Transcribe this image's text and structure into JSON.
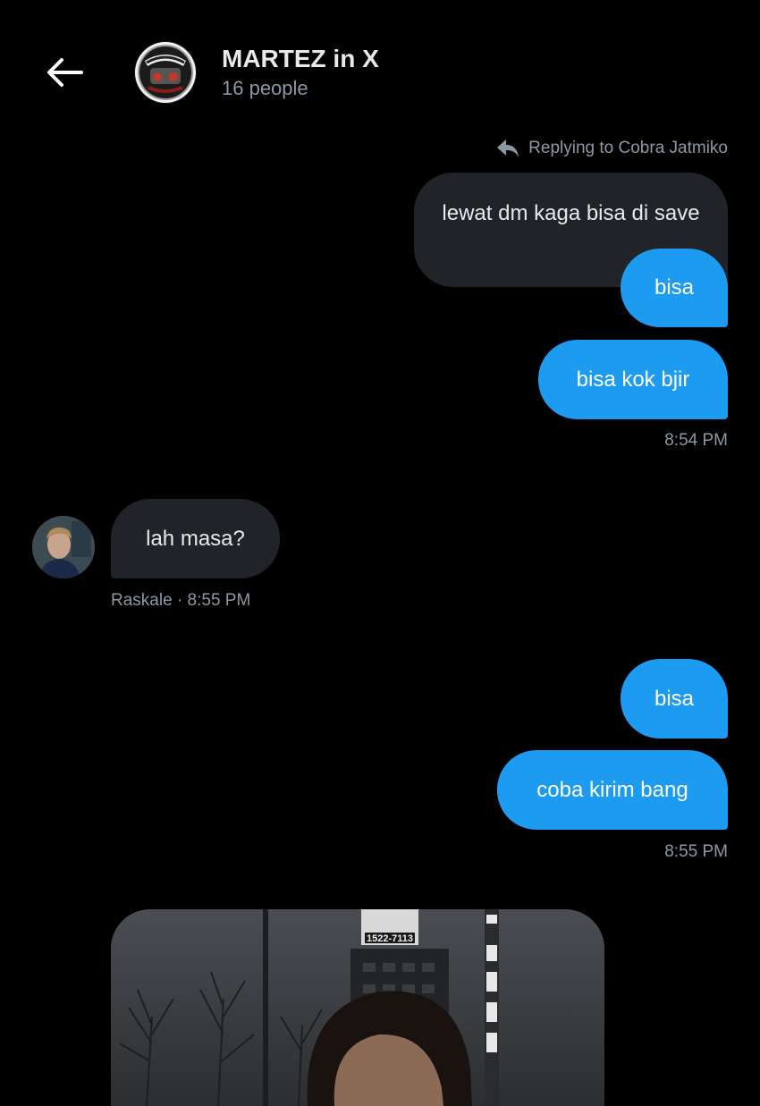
{
  "header": {
    "title": "MARTEZ in X",
    "subtitle": "16 people",
    "back_icon": "arrow-left-icon",
    "avatar_text": "MARTEZ"
  },
  "thread": {
    "reply_context": "Replying to Cobra Jatmiko",
    "messages": [
      {
        "side": "right",
        "style": "gray",
        "text": "lewat dm kaga bisa di save"
      },
      {
        "side": "right",
        "style": "blue",
        "text": "bisa"
      },
      {
        "side": "right",
        "style": "blue",
        "text": "bisa kok bjir"
      },
      {
        "side": "left",
        "style": "gray",
        "text": "lah masa?"
      },
      {
        "side": "right",
        "style": "blue",
        "text": "bisa"
      },
      {
        "side": "right",
        "style": "blue",
        "text": "coba kirim bang"
      }
    ],
    "timestamps": {
      "group1": "8:54 PM",
      "incoming": "Raskale · 8:55 PM",
      "group2": "8:55 PM"
    },
    "photo": {
      "sign_text": "1522-7113"
    }
  },
  "colors": {
    "background": "#000000",
    "accent": "#1d9bf0",
    "bubble_gray": "#202327",
    "muted_text": "#8b98a5"
  }
}
